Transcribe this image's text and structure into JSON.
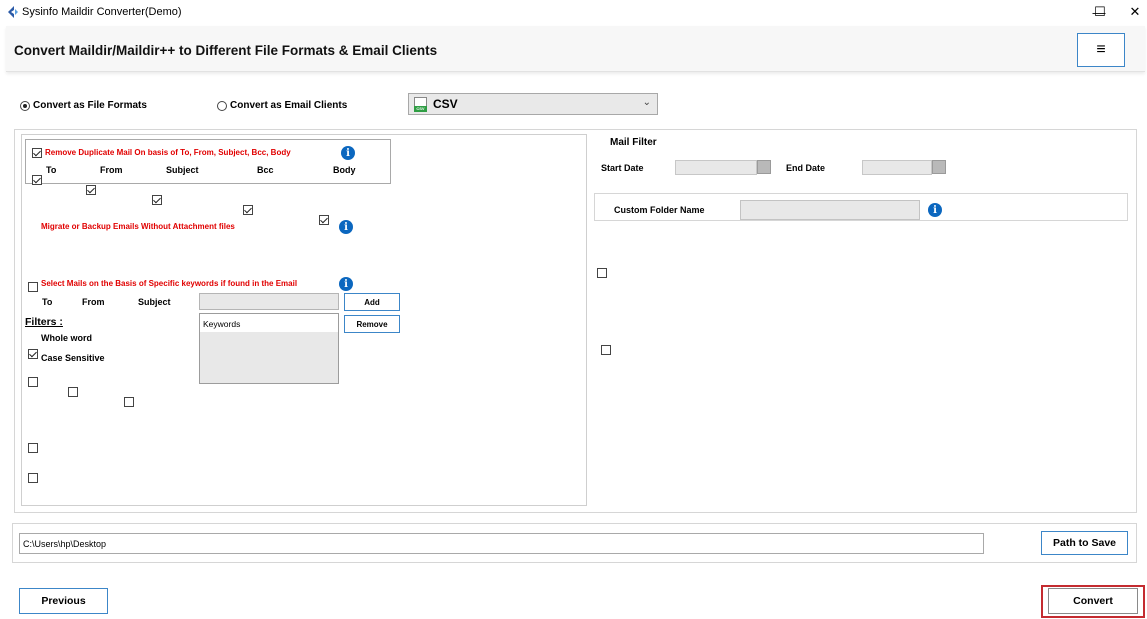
{
  "window": {
    "title": "Sysinfo Maildir Converter(Demo)",
    "minimize_glyph": "—",
    "maximize_glyph": "☐",
    "close_glyph": "✕"
  },
  "header": {
    "title": "Convert Maildir/Maildir++ to Different File Formats & Email Clients",
    "menu_glyph": "≡"
  },
  "conversion_mode": {
    "file_formats_label": "Convert as File Formats",
    "file_formats_selected": true,
    "email_clients_label": "Convert as Email Clients",
    "email_clients_selected": false,
    "format_select_value": "CSV",
    "format_icon_text": "CSV",
    "caret": "⌄"
  },
  "duplicate": {
    "label": "Remove Duplicate Mail On basis of To, From, Subject, Bcc, Body",
    "checked": true,
    "fields": [
      {
        "label": "To",
        "checked": true
      },
      {
        "label": "From",
        "checked": true
      },
      {
        "label": "Subject",
        "checked": true
      },
      {
        "label": "Bcc",
        "checked": true
      },
      {
        "label": "Body",
        "checked": true
      }
    ],
    "info_glyph": "i"
  },
  "attachments": {
    "label": "Migrate or Backup Emails Without Attachment files",
    "checked": false,
    "info_glyph": "i"
  },
  "keywords": {
    "label": "Select Mails on the Basis of Specific keywords if found in the Email",
    "checked": true,
    "info_glyph": "i",
    "fields": [
      {
        "label": "To",
        "checked": false
      },
      {
        "label": "From",
        "checked": false
      },
      {
        "label": "Subject",
        "checked": false
      }
    ],
    "input_value": "",
    "add_label": "Add",
    "remove_label": "Remove",
    "list_header": "Keywords",
    "filters_title": "Filters :",
    "filters": [
      {
        "label": "Whole word",
        "checked": false
      },
      {
        "label": "Case Sensitive",
        "checked": false
      }
    ]
  },
  "mail_filter": {
    "label": "Mail Filter",
    "checked": false,
    "start_label": "Start Date",
    "end_label": "End Date",
    "start_value": "",
    "end_value": ""
  },
  "custom_folder": {
    "label": "Custom Folder Name",
    "checked": false,
    "value": "",
    "info_glyph": "i"
  },
  "save": {
    "path_value": "C:\\Users\\hp\\Desktop",
    "path_button": "Path to Save"
  },
  "footer": {
    "previous_label": "Previous",
    "convert_label": "Convert"
  },
  "colors": {
    "accent_border": "#3c86c8",
    "info_blue": "#0b67bf",
    "warning_red": "#e10000",
    "convert_highlight": "#c42b30"
  }
}
